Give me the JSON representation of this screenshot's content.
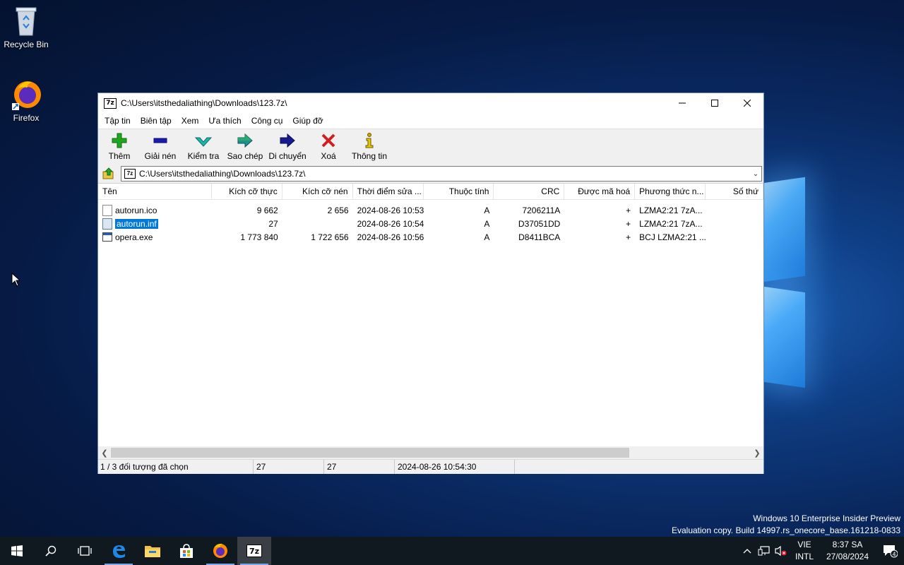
{
  "desktop": {
    "icons": [
      {
        "label": "Recycle Bin",
        "icon": "recycle-bin-icon"
      },
      {
        "label": "Firefox",
        "icon": "firefox-icon"
      }
    ],
    "watermark_line1": "Windows 10 Enterprise Insider Preview",
    "watermark_line2": "Evaluation copy. Build 14997.rs_onecore_base.161218-0833"
  },
  "window": {
    "app_icon_text": "7z",
    "title": "C:\\Users\\itsthedaliathing\\Downloads\\123.7z\\",
    "menu": [
      "Tập tin",
      "Biên tập",
      "Xem",
      "Ưa thích",
      "Công cụ",
      "Giúp đỡ"
    ],
    "toolbar": [
      {
        "label": "Thêm",
        "icon": "add-plus-icon",
        "color": "#1fa51f"
      },
      {
        "label": "Giải nén",
        "icon": "extract-minus-icon",
        "color": "#1a1ab0"
      },
      {
        "label": "Kiểm tra",
        "icon": "test-check-icon",
        "color": "#1fb5a8"
      },
      {
        "label": "Sao chép",
        "icon": "copy-arrow-icon",
        "color": "#1f8f8f"
      },
      {
        "label": "Di chuyển",
        "icon": "move-arrow-icon",
        "color": "#1a1a90"
      },
      {
        "label": "Xoá",
        "icon": "delete-x-icon",
        "color": "#d01f1f"
      },
      {
        "label": "Thông tin",
        "icon": "info-icon",
        "color": "#c8a800"
      }
    ],
    "address": "C:\\Users\\itsthedaliathing\\Downloads\\123.7z\\",
    "columns": [
      "Tên",
      "Kích cỡ thực",
      "Kích cỡ nén",
      "Thời điểm sửa ...",
      "Thuộc tính",
      "CRC",
      "Được mã hoá",
      "Phương thức n...",
      "Số thứ"
    ],
    "files": [
      {
        "name": "autorun.ico",
        "size": "9 662",
        "packed": "2 656",
        "modified": "2024-08-26 10:53",
        "attr": "A",
        "crc": "7206211A",
        "encrypted": "+",
        "method": "LZMA2:21 7zA...",
        "selected": false
      },
      {
        "name": "autorun.inf",
        "size": "27",
        "packed": "",
        "modified": "2024-08-26 10:54",
        "attr": "A",
        "crc": "D37051DD",
        "encrypted": "+",
        "method": "LZMA2:21 7zA...",
        "selected": true
      },
      {
        "name": "opera.exe",
        "size": "1 773 840",
        "packed": "1 722 656",
        "modified": "2024-08-26 10:56",
        "attr": "A",
        "crc": "D8411BCA",
        "encrypted": "+",
        "method": "BCJ LZMA2:21 ...",
        "selected": false
      }
    ],
    "status": {
      "selection": "1 / 3 đối tượng đã chọn",
      "size": "27",
      "packed": "27",
      "modified": "2024-08-26 10:54:30"
    }
  },
  "taskbar": {
    "lang_line1": "VIE",
    "lang_line2": "INTL",
    "time": "8:37 SA",
    "date": "27/08/2024",
    "notification_count": "4"
  }
}
